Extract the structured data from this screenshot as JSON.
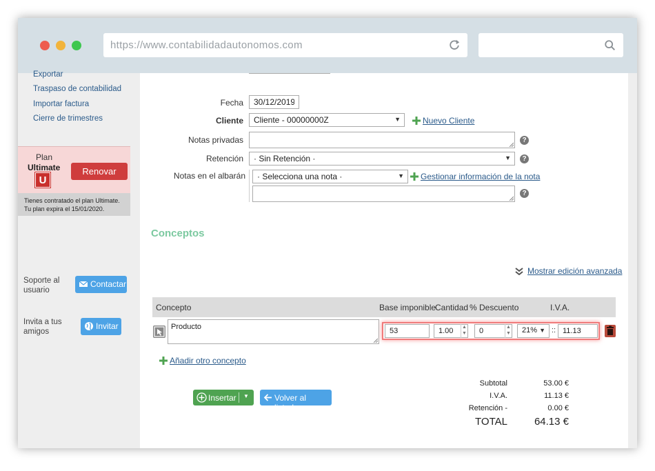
{
  "browser": {
    "url": "https://www.contabilidadautonomos.com"
  },
  "sidebar": {
    "links": [
      "Exportar",
      "Traspaso de contabilidad",
      "Importar factura",
      "Cierre de trimestres"
    ],
    "plan": {
      "label": "Plan",
      "name": "Ultimate",
      "badge": "U",
      "renew_label": "Renovar",
      "info_line1": "Tienes contratado el plan Ultimate.",
      "info_line2": "Tu plan expira el 15/01/2020."
    },
    "support": {
      "text_line1": "Soporte al",
      "text_line2": "usuario",
      "button_label": "Contactar"
    },
    "invite": {
      "text_line1": "Invita a tus",
      "text_line2": "amigos",
      "button_label": "Invitar"
    }
  },
  "form": {
    "fecha_label": "Fecha",
    "fecha_value": "30/12/2019",
    "cliente_label": "Cliente",
    "cliente_value": "Cliente - 00000000Z",
    "nuevo_cliente": "Nuevo Cliente",
    "notas_privadas_label": "Notas privadas",
    "retencion_label": "Retención",
    "retencion_value": "· Sin Retención ·",
    "notas_albaran_label": "Notas en el albarán",
    "nota_select_value": "· Selecciona una nota ·",
    "gestionar_nota": "Gestionar información de la nota",
    "help_glyph": "?"
  },
  "conceptos": {
    "title": "Conceptos",
    "advanced_link": "Mostrar edición avanzada",
    "headers": {
      "concepto": "Concepto",
      "base": "Base imponible",
      "cantidad": "Cantidad",
      "descuento": "% Descuento",
      "iva": "I.V.A."
    },
    "row": {
      "concepto": "Producto",
      "base": "53",
      "cantidad": "1.00",
      "descuento": "0",
      "iva_rate": "21%",
      "iva_sep": "::",
      "iva_amount": "11.13"
    },
    "add_link": "Añadir otro concepto"
  },
  "totals": {
    "subtotal_label": "Subtotal",
    "subtotal_value": "53.00 €",
    "iva_label": "I.V.A.",
    "iva_value": "11.13 €",
    "retencion_label": "Retención -",
    "retencion_value": "0.00 €",
    "total_label": "TOTAL",
    "total_value": "64.13 €"
  },
  "actions": {
    "insert_label": "Insertar",
    "back_label": "Volver al listado"
  },
  "colors": {
    "accent_green": "#4fa351",
    "accent_blue": "#4da3e6",
    "renew_red": "#cf3d3d",
    "section_green": "#7cc9a0"
  }
}
